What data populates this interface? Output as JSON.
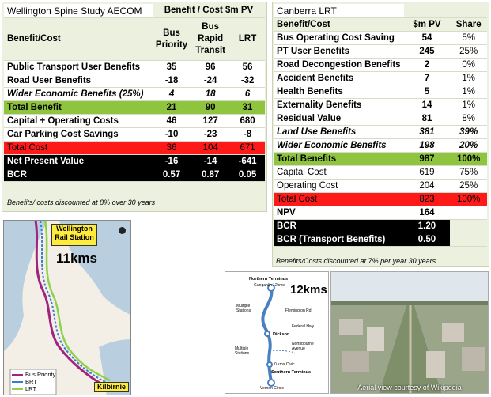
{
  "wellington": {
    "title": "Wellington Spine Study AECOM",
    "header_group": "Benefit / Cost $m PV",
    "row_header": "Benefit/Cost",
    "col1": [
      "Bus",
      "Priority"
    ],
    "col2": [
      "Bus",
      "Rapid",
      "Transit"
    ],
    "col3": "LRT",
    "rows": [
      {
        "label": "Public Transport User Benefits",
        "v": [
          "35",
          "96",
          "56"
        ]
      },
      {
        "label": "Road User Benefits",
        "v": [
          "-18",
          "-24",
          "-32"
        ]
      },
      {
        "label": "Wider Economic Benefits (25%)",
        "v": [
          "4",
          "18",
          "6"
        ]
      },
      {
        "label": "Total Benefit",
        "v": [
          "21",
          "90",
          "31"
        ]
      },
      {
        "label": "Capital + Operating Costs",
        "v": [
          "46",
          "127",
          "680"
        ]
      },
      {
        "label": "Car Parking Cost Savings",
        "v": [
          "-10",
          "-23",
          "-8"
        ]
      },
      {
        "label": "Total Cost",
        "v": [
          "36",
          "104",
          "671"
        ]
      },
      {
        "label": "Net Present Value",
        "v": [
          "-16",
          "-14",
          "-641"
        ]
      },
      {
        "label": "BCR",
        "v": [
          "0.57",
          "0.87",
          "0.05"
        ]
      }
    ],
    "note": "Benefits/ costs discounted at 8% over 30 years"
  },
  "canberra": {
    "title": "Canberra LRT",
    "headers": [
      "Benefit/Cost",
      "$m PV",
      "Share"
    ],
    "rows": [
      {
        "label": "Bus Operating Cost Saving",
        "v": "54",
        "s": "5%"
      },
      {
        "label": "PT User Benefits",
        "v": "245",
        "s": "25%"
      },
      {
        "label": "Road Decongestion Benefits",
        "v": "2",
        "s": "0%"
      },
      {
        "label": "Accident Benefits",
        "v": "7",
        "s": "1%"
      },
      {
        "label": "Health Benefits",
        "v": "5",
        "s": "1%"
      },
      {
        "label": "Externality Benefits",
        "v": "14",
        "s": "1%"
      },
      {
        "label": "Residual Value",
        "v": "81",
        "s": "8%"
      },
      {
        "label": "Land Use Benefits",
        "v": "381",
        "s": "39%"
      },
      {
        "label": "Wider Economic Benefits",
        "v": "198",
        "s": "20%"
      },
      {
        "label": "Total Benefits",
        "v": "987",
        "s": "100%"
      },
      {
        "label": "Capital Cost",
        "v": "619",
        "s": "75%"
      },
      {
        "label": "Operating Cost",
        "v": "204",
        "s": "25%"
      },
      {
        "label": "Total Cost",
        "v": "823",
        "s": "100%"
      },
      {
        "label": "NPV",
        "v": "164",
        "s": ""
      },
      {
        "label": "BCR",
        "v": "1.20",
        "s": ""
      },
      {
        "label": "BCR (Transport Benefits)",
        "v": "0.50",
        "s": ""
      }
    ],
    "note": "Benefits/Costs discounted at 7% per year 30 years"
  },
  "wellington_map": {
    "station_callout": "Wellington Rail Station",
    "end_callout": "Kilbirnie",
    "distance": "11kms",
    "legend": [
      "Bus Priority",
      "BRT",
      "LRT"
    ],
    "legend_colors": [
      "#a0237f",
      "#3a7ccf",
      "#8ed14a"
    ]
  },
  "canberra_diagram": {
    "distance": "12kms",
    "north": "Northern Terminus",
    "gungahlin": "Gungahlin 12kms",
    "stations_a": "Multiple Stations",
    "flemington": "Flemington Rd",
    "federal": "Federal Hwy",
    "dickson": "Dickson",
    "northbourne": "Northbourne Avenue",
    "stations_b": "Multiple Stations",
    "civic": "0 kms Civic",
    "south": "Southern Terminus",
    "vernon": "Vernon Circle"
  },
  "photo": {
    "caption": "Aerial view courtesy of Wikipedia"
  }
}
